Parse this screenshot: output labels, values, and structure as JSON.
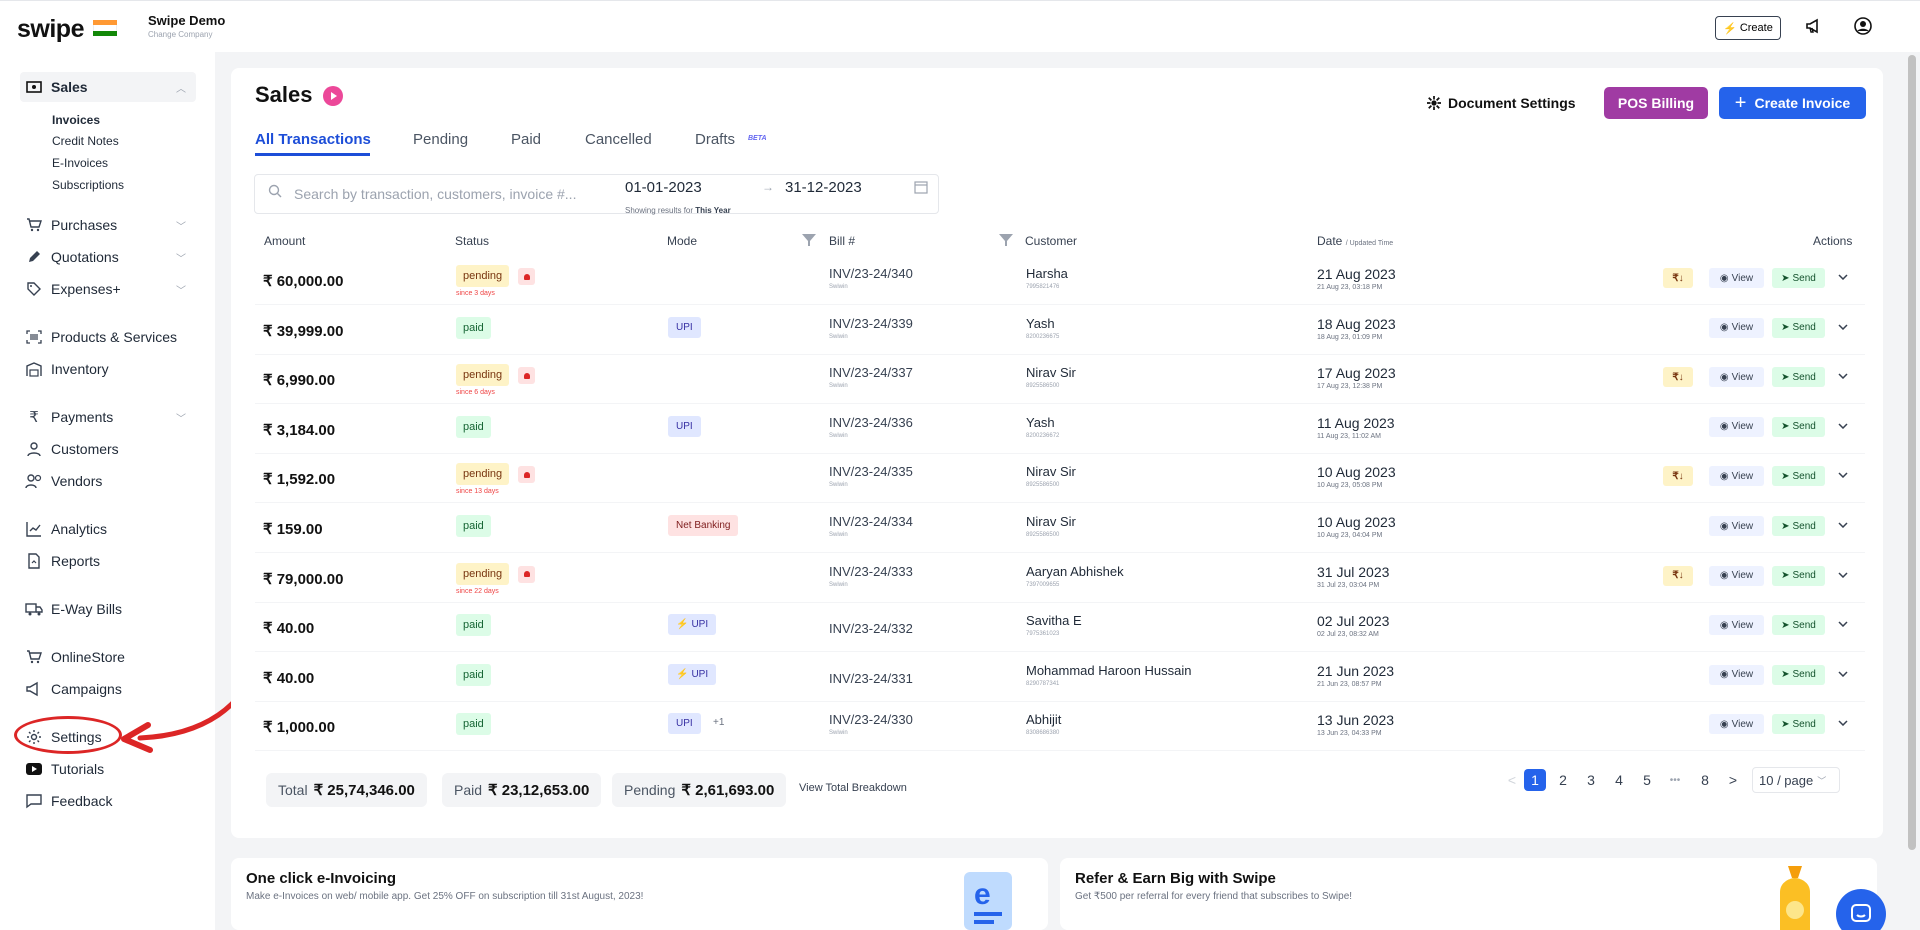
{
  "app": {
    "logo": "swipe",
    "company_name": "Swipe Demo",
    "change_company": "Change Company"
  },
  "topbar": {
    "create_label": "Create",
    "icons": [
      "megaphone-icon",
      "user-icon"
    ]
  },
  "sidebar": {
    "sales_label": "Sales",
    "sales_sub": [
      "Invoices",
      "Credit Notes",
      "E-Invoices",
      "Subscriptions"
    ],
    "items": [
      "Purchases",
      "Quotations",
      "Expenses+",
      "Products & Services",
      "Inventory",
      "Payments",
      "Customers",
      "Vendors",
      "Analytics",
      "Reports",
      "E-Way Bills",
      "OnlineStore",
      "Campaigns",
      "Settings",
      "Tutorials",
      "Feedback"
    ],
    "highlighted": "Settings"
  },
  "page": {
    "title": "Sales",
    "tabs": [
      "All Transactions",
      "Pending",
      "Paid",
      "Cancelled",
      "Drafts"
    ],
    "beta": "BETA",
    "doc_settings": "Document Settings",
    "pos_billing": "POS Billing",
    "create_invoice": "Create Invoice",
    "search_placeholder": "Search by transaction, customers, invoice #...",
    "date_from": "01-01-2023",
    "date_to": "31-12-2023",
    "showing_prefix": "Showing results for",
    "showing_period": "This Year"
  },
  "table": {
    "headers": {
      "amount": "Amount",
      "status": "Status",
      "mode": "Mode",
      "bill": "Bill #",
      "customer": "Customer",
      "date": "Date",
      "date_sub": "/ Updated Time",
      "actions": "Actions"
    },
    "view_label": "View",
    "send_label": "Send",
    "rupee_label": "₹↓",
    "rows": [
      {
        "amount": "₹ 60,000.00",
        "status": "pending",
        "since": "since 3 days",
        "mode": "",
        "bill": "INV/23-24/340",
        "bill_sub": "Swiwin",
        "customer": "Harsha",
        "cust_sub": "7995821476",
        "date": "21 Aug 2023",
        "date_sub": "21 Aug 23, 03:18 PM"
      },
      {
        "amount": "₹ 39,999.00",
        "status": "paid",
        "mode": "UPI",
        "bill": "INV/23-24/339",
        "bill_sub": "Swiwin",
        "customer": "Yash",
        "cust_sub": "8200236675",
        "date": "18 Aug 2023",
        "date_sub": "18 Aug 23, 01:09 PM"
      },
      {
        "amount": "₹ 6,990.00",
        "status": "pending",
        "since": "since 6 days",
        "mode": "",
        "bill": "INV/23-24/337",
        "bill_sub": "Swiwin",
        "customer": "Nirav Sir",
        "cust_sub": "8925586500",
        "date": "17 Aug 2023",
        "date_sub": "17 Aug 23, 12:38 PM"
      },
      {
        "amount": "₹ 3,184.00",
        "status": "paid",
        "mode": "UPI",
        "bill": "INV/23-24/336",
        "bill_sub": "Swiwin",
        "customer": "Yash",
        "cust_sub": "8200236672",
        "date": "11 Aug 2023",
        "date_sub": "11 Aug 23, 11:02 AM"
      },
      {
        "amount": "₹ 1,592.00",
        "status": "pending",
        "since": "since 13 days",
        "mode": "",
        "bill": "INV/23-24/335",
        "bill_sub": "Swiwin",
        "customer": "Nirav Sir",
        "cust_sub": "8925586500",
        "date": "10 Aug 2023",
        "date_sub": "10 Aug 23, 05:08 PM"
      },
      {
        "amount": "₹ 159.00",
        "status": "paid",
        "mode": "Net Banking",
        "bill": "INV/23-24/334",
        "bill_sub": "Swiwin",
        "customer": "Nirav Sir",
        "cust_sub": "8925586500",
        "date": "10 Aug 2023",
        "date_sub": "10 Aug 23, 04:04 PM"
      },
      {
        "amount": "₹ 79,000.00",
        "status": "pending",
        "since": "since 22 days",
        "mode": "",
        "bill": "INV/23-24/333",
        "bill_sub": "Swiwin",
        "customer": "Aaryan Abhishek",
        "cust_sub": "7397009655",
        "date": "31 Jul 2023",
        "date_sub": "31 Jul 23, 03:04 PM"
      },
      {
        "amount": "₹ 40.00",
        "status": "paid",
        "mode": "UPI",
        "bill": "INV/23-24/332",
        "bill_sub": "",
        "customer": "Savitha E",
        "cust_sub": "7975361023",
        "date": "02 Jul 2023",
        "date_sub": "02 Jul 23, 08:32 AM"
      },
      {
        "amount": "₹ 40.00",
        "status": "paid",
        "mode": "UPI",
        "bill": "INV/23-24/331",
        "bill_sub": "",
        "customer": "Mohammad Haroon Hussain",
        "cust_sub": "8290787341",
        "date": "21 Jun 2023",
        "date_sub": "21 Jun 23, 08:57 PM"
      },
      {
        "amount": "₹ 1,000.00",
        "status": "paid",
        "mode": "UPI",
        "mode_extra": "+1",
        "bill": "INV/23-24/330",
        "bill_sub": "Swiwin",
        "customer": "Abhijit",
        "cust_sub": "8308686380",
        "date": "13 Jun 2023",
        "date_sub": "13 Jun 23, 04:33 PM"
      }
    ]
  },
  "totals": {
    "total_label": "Total",
    "total_value": "₹ 25,74,346.00",
    "paid_label": "Paid",
    "paid_value": "₹ 23,12,653.00",
    "pending_label": "Pending",
    "pending_value": "₹ 2,61,693.00",
    "breakdown": "View Total Breakdown"
  },
  "pagination": {
    "prev": "<",
    "pages": [
      "1",
      "2",
      "3",
      "4",
      "5",
      "•••",
      "8"
    ],
    "next": ">",
    "per_page": "10 / page",
    "active_page": "1"
  },
  "promos": [
    {
      "title": "One click e-Invoicing",
      "text": "Make e-Invoices on web/ mobile app. Get 25% OFF on subscription till 31st August, 2023!"
    },
    {
      "title": "Refer & Earn Big with Swipe",
      "text": "Get ₹500 per referral for every friend that subscribes to Swipe!"
    }
  ],
  "colors": {
    "primary": "#2563eb",
    "pos": "#a03ba3",
    "highlight": "#dc2626",
    "paid_bg": "#dcfce7",
    "pending_bg": "#fef3c7"
  }
}
